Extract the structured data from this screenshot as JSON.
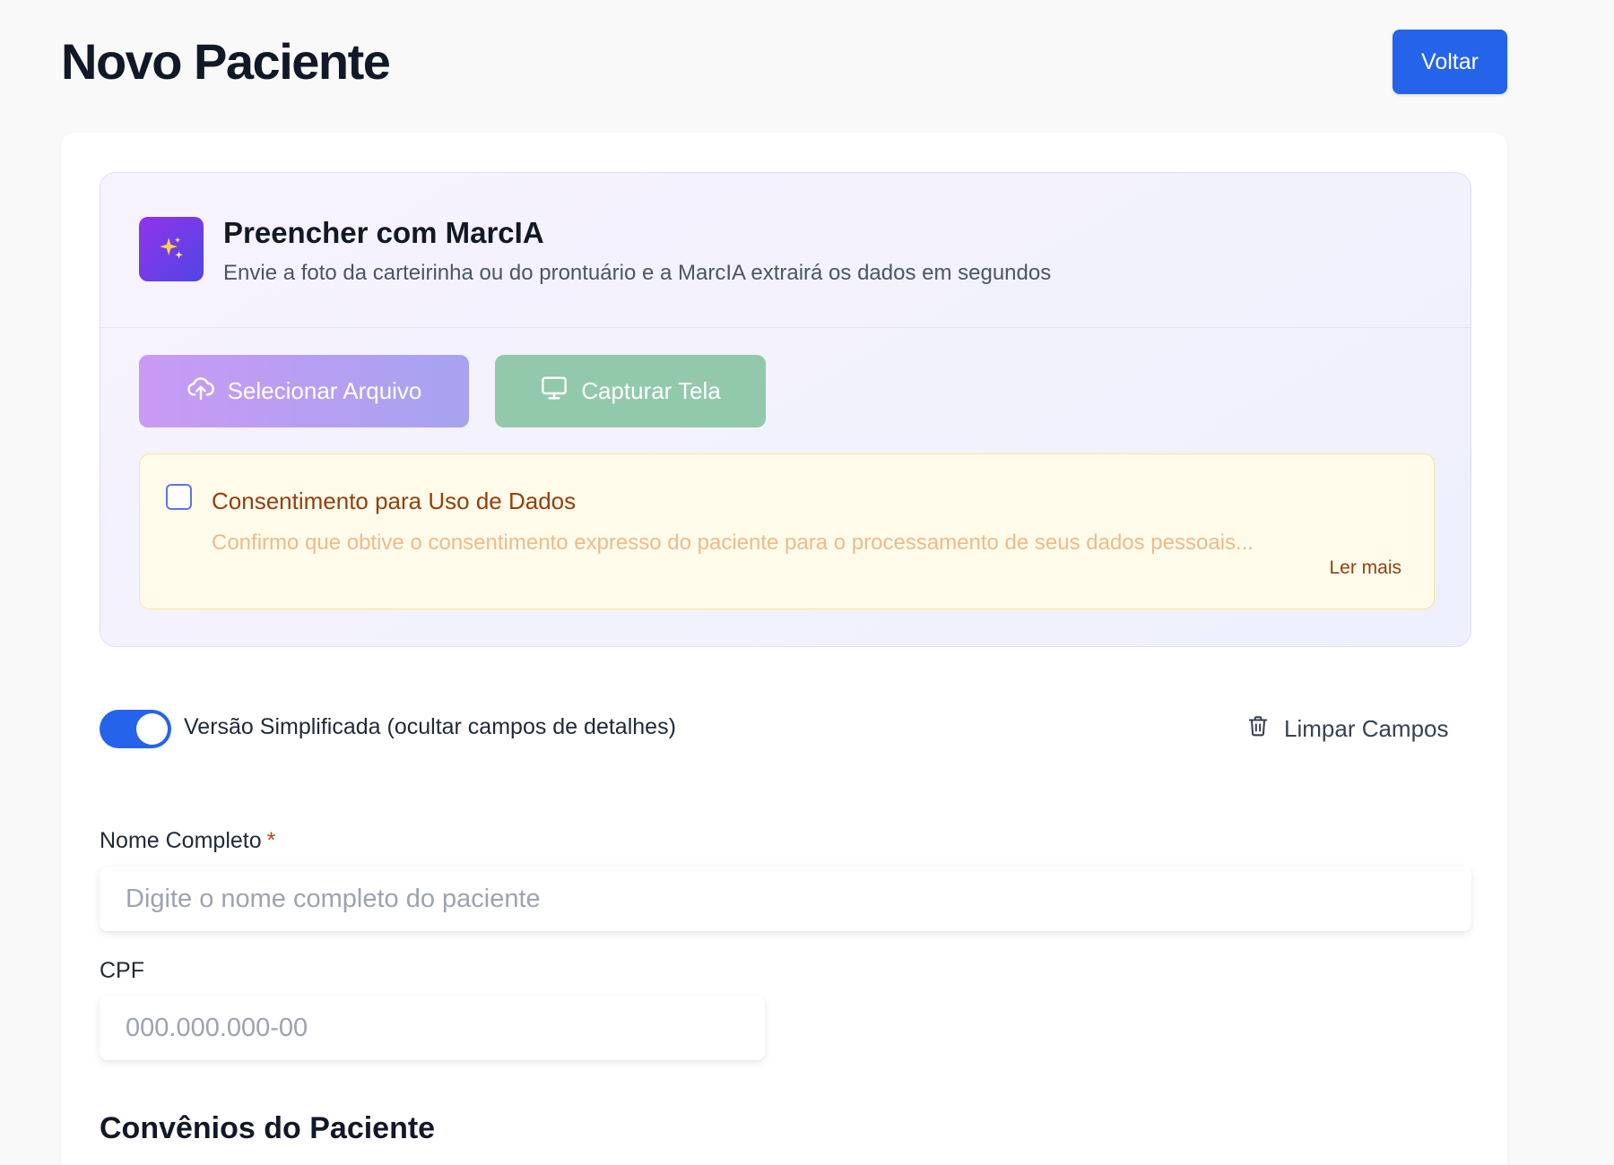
{
  "header": {
    "title": "Novo Paciente",
    "back_label": "Voltar"
  },
  "ai_panel": {
    "title": "Preencher com MarcIA",
    "subtitle": "Envie a foto da carteirinha ou do prontuário e a MarcIA extrairá os dados em segundos",
    "upload_label": "Selecionar Arquivo",
    "capture_label": "Capturar Tela"
  },
  "consent": {
    "title": "Consentimento para Uso de Dados",
    "text": "Confirmo que obtive o consentimento expresso do paciente para o processamento de seus dados pessoais...",
    "read_more": "Ler mais",
    "checked": false
  },
  "options": {
    "simplified_label": "Versão Simplificada (ocultar campos de detalhes)",
    "simplified_on": true,
    "clear_label": "Limpar Campos"
  },
  "form": {
    "name_label": "Nome Completo",
    "name_required": "*",
    "name_placeholder": "Digite o nome completo do paciente",
    "cpf_label": "CPF",
    "cpf_placeholder": "000.000.000-00"
  },
  "insurance": {
    "title": "Convênios do Paciente"
  },
  "colors": {
    "primary": "#2563eb",
    "ai_gradient_start": "#9333ea",
    "ai_gradient_end": "#4f46e5",
    "consent_text": "#92400e"
  },
  "icons": {
    "ai_logo": "sparkles-icon",
    "upload": "cloud-upload-icon",
    "capture": "monitor-icon",
    "clear": "trash-icon"
  }
}
